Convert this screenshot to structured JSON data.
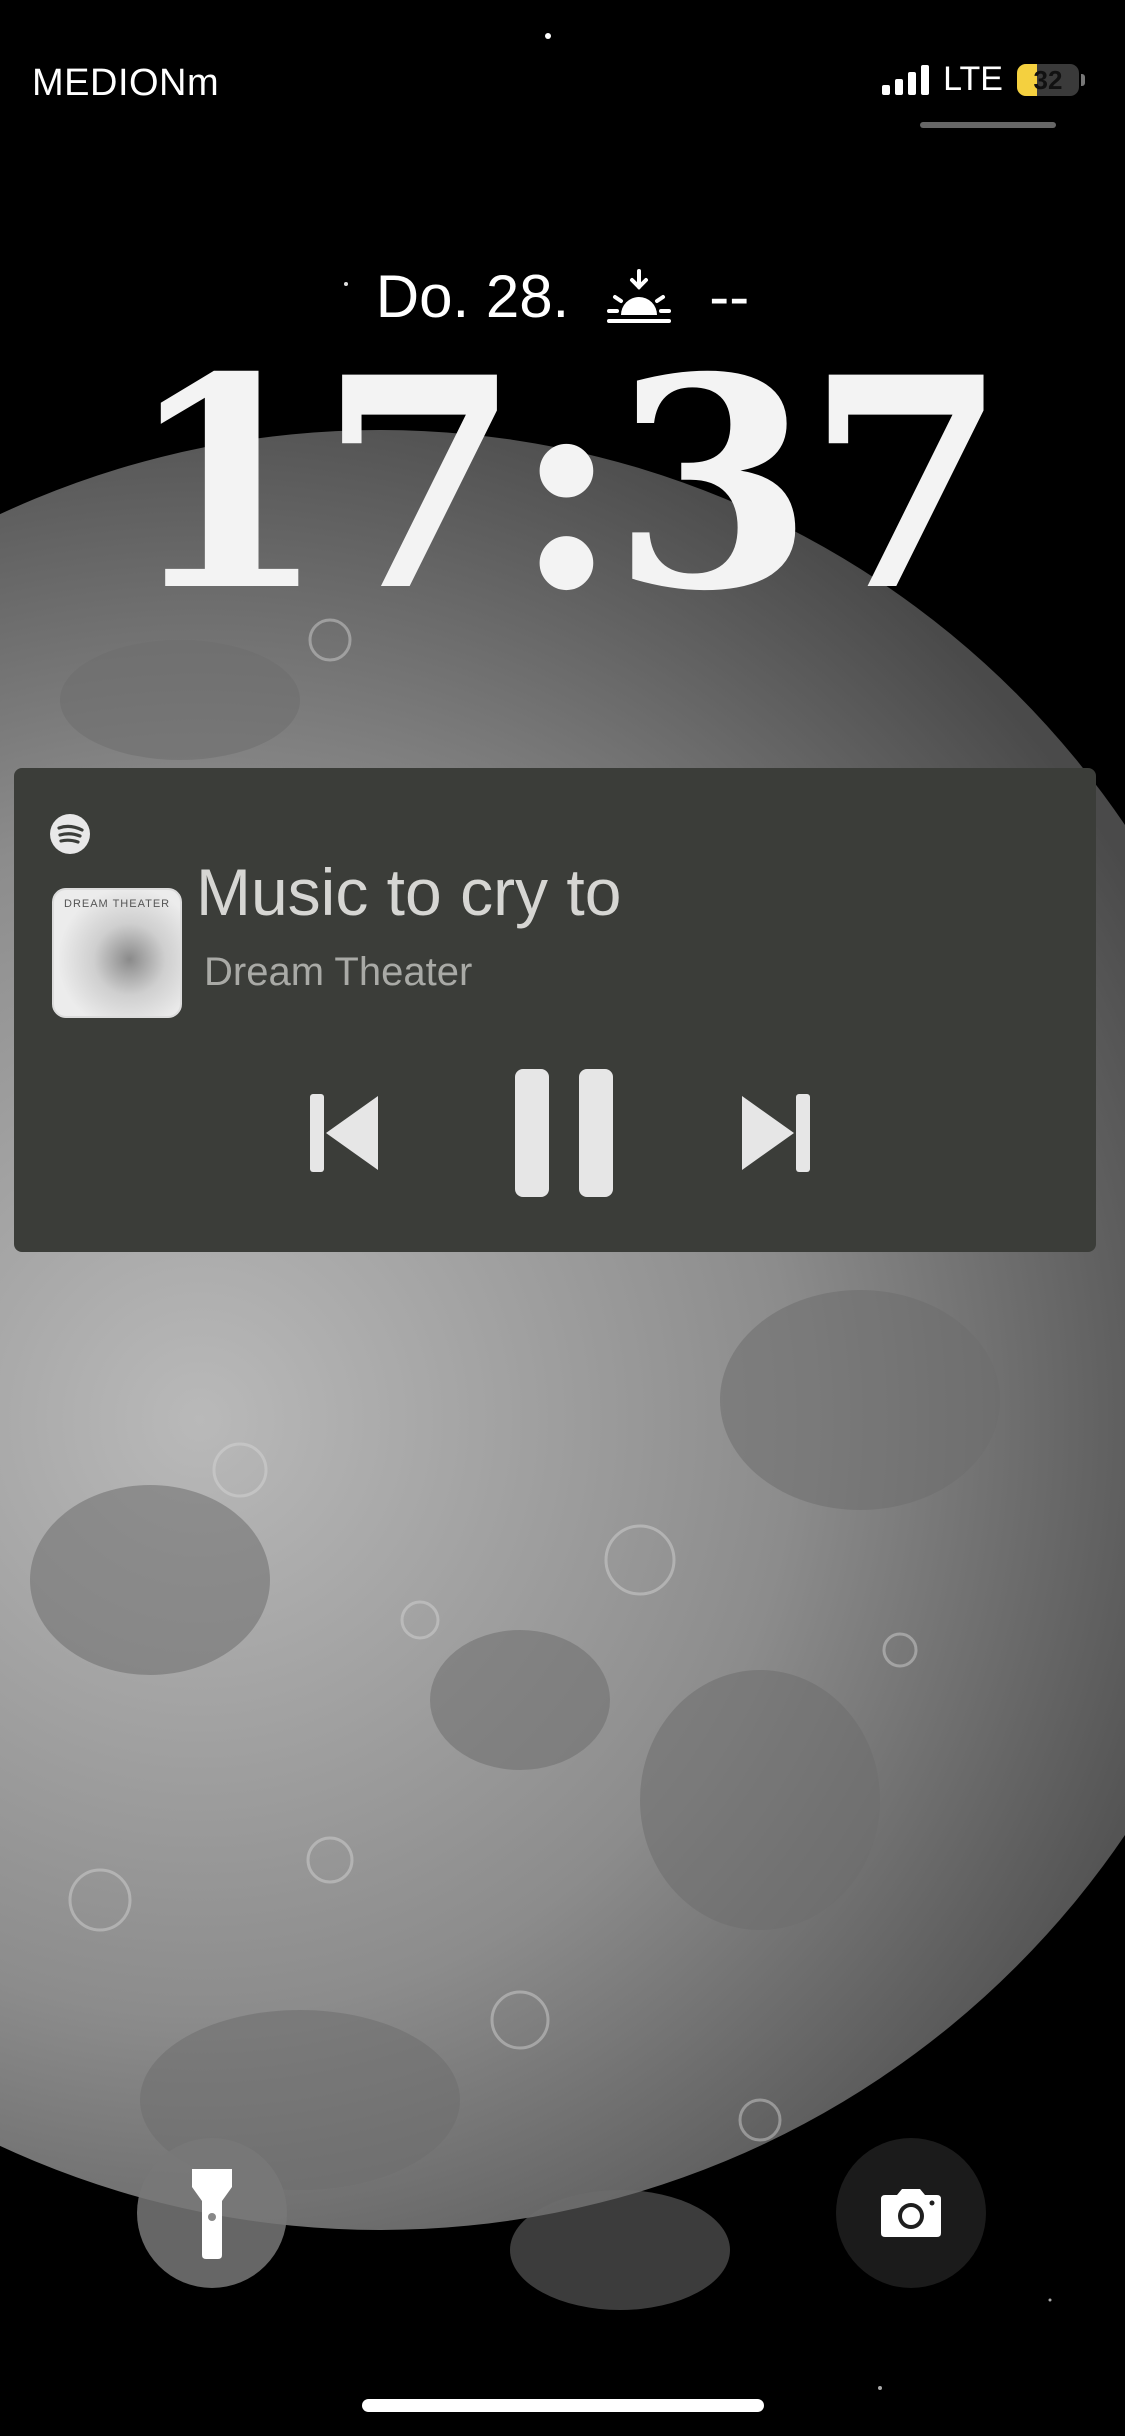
{
  "status_bar": {
    "carrier": "MEDIONm",
    "network": "LTE",
    "battery_level": "32",
    "battery_fraction": 0.32
  },
  "lock_screen": {
    "date": "Do. 28.",
    "sun_value": "--",
    "time": "17:37"
  },
  "now_playing": {
    "app_icon": "spotify-icon",
    "album_art_text": "DREAM THEATER",
    "title": "Music to cry to",
    "artist": "Dream Theater",
    "controls": [
      "previous-icon",
      "pause-icon",
      "next-icon"
    ]
  },
  "quick_actions": {
    "left": "flashlight-icon",
    "right": "camera-icon"
  },
  "colors": {
    "player_bg": "#3b3d39",
    "battery_accent": "#f4d03f",
    "background": "#000000"
  }
}
